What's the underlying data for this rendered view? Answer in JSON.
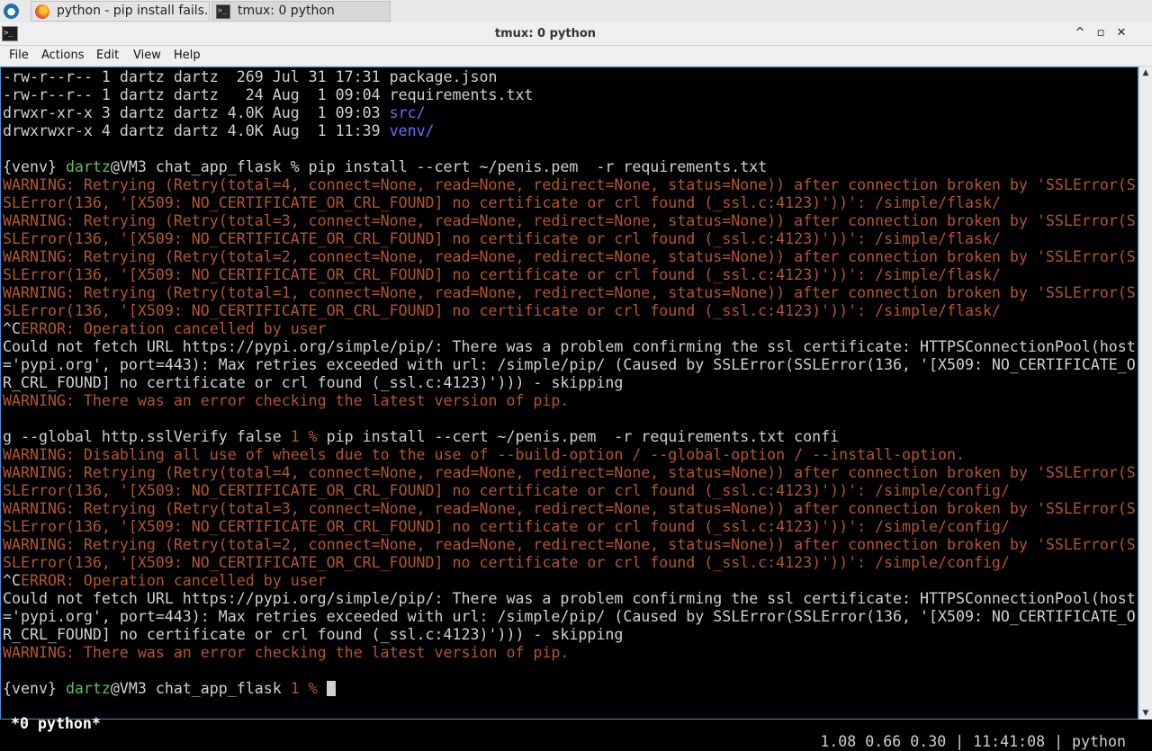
{
  "taskbar": {
    "app_menu_icon": "app-launcher-icon",
    "tasks": [
      {
        "label": "python - pip install fails...",
        "icon": "firefox-icon"
      },
      {
        "label": "tmux: 0 python",
        "icon": "terminal-icon"
      }
    ]
  },
  "window": {
    "title": "tmux: 0 python",
    "icon": "terminal-icon",
    "controls": {
      "minimize": "^",
      "maximize": "▫",
      "close": "✕"
    }
  },
  "menubar": [
    "File",
    "Actions",
    "Edit",
    "View",
    "Help"
  ],
  "terminal": {
    "lines": [
      [
        {
          "t": "-rw-r--r-- 1 dartz dartz  269 Jul 31 17:31 package.json"
        }
      ],
      [
        {
          "t": "-rw-r--r-- 1 dartz dartz   24 Aug  1 09:04 requirements.txt"
        }
      ],
      [
        {
          "t": "drwxr-xr-x 3 dartz dartz 4.0K Aug  1 09:03 "
        },
        {
          "t": "src/",
          "c": "b"
        }
      ],
      [
        {
          "t": "drwxrwxr-x 4 dartz dartz 4.0K Aug  1 11:39 "
        },
        {
          "t": "venv/",
          "c": "b"
        }
      ],
      [
        {
          "t": ""
        }
      ],
      [
        {
          "t": "{venv} "
        },
        {
          "t": "dartz",
          "c": "d"
        },
        {
          "t": "@VM3 chat_app_flask % pip install --cert ~/penis.pem  -r requirements.txt"
        }
      ],
      [
        {
          "t": "WARNING: Retrying (Retry(total=4, connect=None, read=None, redirect=None, status=None)) after connection broken by 'SSLError(S",
          "c": "w"
        }
      ],
      [
        {
          "t": "SLError(136, '[X509: NO_CERTIFICATE_OR_CRL_FOUND] no certificate or crl found (_ssl.c:4123)'))': /simple/flask/",
          "c": "w"
        }
      ],
      [
        {
          "t": "WARNING: Retrying (Retry(total=3, connect=None, read=None, redirect=None, status=None)) after connection broken by 'SSLError(S",
          "c": "w"
        }
      ],
      [
        {
          "t": "SLError(136, '[X509: NO_CERTIFICATE_OR_CRL_FOUND] no certificate or crl found (_ssl.c:4123)'))': /simple/flask/",
          "c": "w"
        }
      ],
      [
        {
          "t": "WARNING: Retrying (Retry(total=2, connect=None, read=None, redirect=None, status=None)) after connection broken by 'SSLError(S",
          "c": "w"
        }
      ],
      [
        {
          "t": "SLError(136, '[X509: NO_CERTIFICATE_OR_CRL_FOUND] no certificate or crl found (_ssl.c:4123)'))': /simple/flask/",
          "c": "w"
        }
      ],
      [
        {
          "t": "WARNING: Retrying (Retry(total=1, connect=None, read=None, redirect=None, status=None)) after connection broken by 'SSLError(S",
          "c": "w"
        }
      ],
      [
        {
          "t": "SLError(136, '[X509: NO_CERTIFICATE_OR_CRL_FOUND] no certificate or crl found (_ssl.c:4123)'))': /simple/flask/",
          "c": "w"
        }
      ],
      [
        {
          "t": "^C"
        },
        {
          "t": "ERROR: Operation cancelled by user",
          "c": "w"
        }
      ],
      [
        {
          "t": "Could not fetch URL https://pypi.org/simple/pip/: There was a problem confirming the ssl certificate: HTTPSConnectionPool(host"
        }
      ],
      [
        {
          "t": "='pypi.org', port=443): Max retries exceeded with url: /simple/pip/ (Caused by SSLError(SSLError(136, '[X509: NO_CERTIFICATE_O"
        }
      ],
      [
        {
          "t": "R_CRL_FOUND] no certificate or crl found (_ssl.c:4123)'))) - skipping"
        }
      ],
      [
        {
          "t": "WARNING: There was an error checking the latest version of pip.",
          "c": "w"
        }
      ],
      [
        {
          "t": ""
        }
      ],
      [
        {
          "t": "g --global http.sslVerify false "
        },
        {
          "t": "1 %",
          "c": "w"
        },
        {
          "t": " pip install --cert ~/penis.pem  -r requirements.txt confi"
        }
      ],
      [
        {
          "t": "WARNING: Disabling all use of wheels due to the use of --build-option / --global-option / --install-option.",
          "c": "w"
        }
      ],
      [
        {
          "t": "WARNING: Retrying (Retry(total=4, connect=None, read=None, redirect=None, status=None)) after connection broken by 'SSLError(S",
          "c": "w"
        }
      ],
      [
        {
          "t": "SLError(136, '[X509: NO_CERTIFICATE_OR_CRL_FOUND] no certificate or crl found (_ssl.c:4123)'))': /simple/config/",
          "c": "w"
        }
      ],
      [
        {
          "t": "WARNING: Retrying (Retry(total=3, connect=None, read=None, redirect=None, status=None)) after connection broken by 'SSLError(S",
          "c": "w"
        }
      ],
      [
        {
          "t": "SLError(136, '[X509: NO_CERTIFICATE_OR_CRL_FOUND] no certificate or crl found (_ssl.c:4123)'))': /simple/config/",
          "c": "w"
        }
      ],
      [
        {
          "t": "WARNING: Retrying (Retry(total=2, connect=None, read=None, redirect=None, status=None)) after connection broken by 'SSLError(S",
          "c": "w"
        }
      ],
      [
        {
          "t": "SLError(136, '[X509: NO_CERTIFICATE_OR_CRL_FOUND] no certificate or crl found (_ssl.c:4123)'))': /simple/config/",
          "c": "w"
        }
      ],
      [
        {
          "t": "^C"
        },
        {
          "t": "ERROR: Operation cancelled by user",
          "c": "w"
        }
      ],
      [
        {
          "t": "Could not fetch URL https://pypi.org/simple/pip/: There was a problem confirming the ssl certificate: HTTPSConnectionPool(host"
        }
      ],
      [
        {
          "t": "='pypi.org', port=443): Max retries exceeded with url: /simple/pip/ (Caused by SSLError(SSLError(136, '[X509: NO_CERTIFICATE_O"
        }
      ],
      [
        {
          "t": "R_CRL_FOUND] no certificate or crl found (_ssl.c:4123)'))) - skipping"
        }
      ],
      [
        {
          "t": "WARNING: There was an error checking the latest version of pip.",
          "c": "w"
        }
      ],
      [
        {
          "t": ""
        }
      ],
      [
        {
          "t": "{venv} "
        },
        {
          "t": "dartz",
          "c": "d"
        },
        {
          "t": "@VM3 chat_app_flask "
        },
        {
          "t": "1 %",
          "c": "w"
        },
        {
          "t": " "
        },
        {
          "cursor": true
        }
      ]
    ]
  },
  "tmux_status": {
    "left": "*0 python*",
    "right": "1.08 0.66 0.30 | 11:41:08 | python"
  },
  "scrollbar": {
    "up_icon": "▲",
    "down_icon": "▼"
  },
  "colors": {
    "warning": "#b4562b",
    "user": "#5fbf5f",
    "directory": "#6a6aff",
    "text": "#d0d0d0",
    "focus_border": "#4a90d9"
  }
}
